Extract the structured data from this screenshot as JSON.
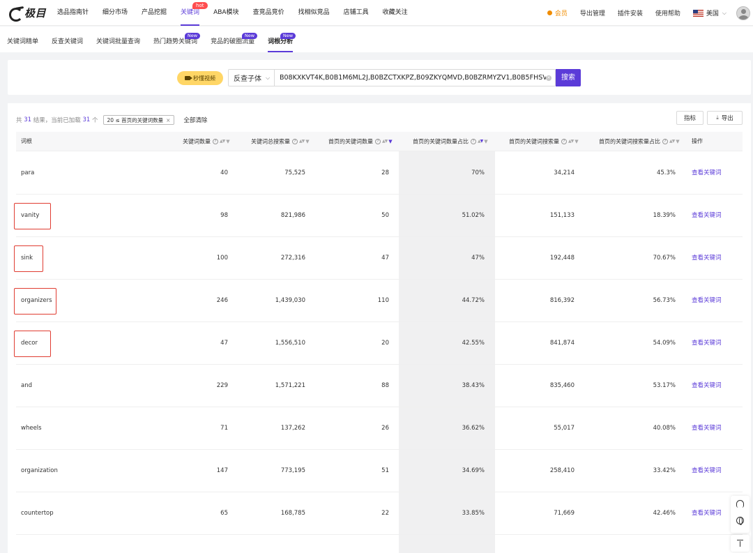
{
  "brand": {
    "logo_text": "极目"
  },
  "top_nav": {
    "items": [
      {
        "label": "选品指南针"
      },
      {
        "label": "细分市场"
      },
      {
        "label": "产品挖掘"
      },
      {
        "label": "关键词",
        "badge": "hot",
        "active": true
      },
      {
        "label": "ABA模块"
      },
      {
        "label": "查竞品竞价"
      },
      {
        "label": "找相似竞品"
      },
      {
        "label": "店铺工具"
      },
      {
        "label": "收藏关注"
      }
    ],
    "right": {
      "vip": "会员",
      "export_manage": "导出管理",
      "plugin_install": "插件安装",
      "help": "使用帮助",
      "region": "美国"
    }
  },
  "sub_nav": {
    "items": [
      {
        "label": "关键词精单"
      },
      {
        "label": "反查关键词"
      },
      {
        "label": "关键词批量查询"
      },
      {
        "label": "热门趋势关键词",
        "badge": "New"
      },
      {
        "label": "竞品的破圈流量",
        "badge": "New"
      },
      {
        "label": "词根分析",
        "badge": "New",
        "active": true
      }
    ]
  },
  "search": {
    "video_btn": "秒懂视频",
    "mode": "反查子体",
    "value": "B08KXKVT4K,B0B1M6ML2J,B0BZCTXKPZ,B09ZKYQMVD,B0BZRMYZV1,B0B5FHSV",
    "button": "搜索"
  },
  "summary": {
    "pre": "共",
    "total": "31",
    "mid": "结果，当前已加载",
    "loaded": "31",
    "post": "个",
    "filter_tag": "20 ≤ 首页的关键词数量",
    "clear_all": "全部清除",
    "metrics_btn": "指标",
    "export_btn": "导出"
  },
  "table": {
    "headers": {
      "root": "词根",
      "kw_count": "关键词数量",
      "kw_search_total": "关键词总搜索量",
      "home_kw_count": "首页的关键词数量",
      "home_kw_ratio": "首页的关键词数量占比",
      "home_kw_search": "首页的关键词搜索量",
      "home_kw_search_ratio": "首页的关键词搜索量占比",
      "action": "操作"
    },
    "rows": [
      {
        "root": "para",
        "kw_count": "40",
        "kw_search_total": "75,525",
        "home_kw_count": "28",
        "home_kw_ratio": "70%",
        "home_kw_search": "34,214",
        "home_kw_search_ratio": "45.3%",
        "action": "查看关键词"
      },
      {
        "root": "vanity",
        "kw_count": "98",
        "kw_search_total": "821,986",
        "home_kw_count": "50",
        "home_kw_ratio": "51.02%",
        "home_kw_search": "151,133",
        "home_kw_search_ratio": "18.39%",
        "action": "查看关键词"
      },
      {
        "root": "sink",
        "kw_count": "100",
        "kw_search_total": "272,316",
        "home_kw_count": "47",
        "home_kw_ratio": "47%",
        "home_kw_search": "192,448",
        "home_kw_search_ratio": "70.67%",
        "action": "查看关键词"
      },
      {
        "root": "organizers",
        "kw_count": "246",
        "kw_search_total": "1,439,030",
        "home_kw_count": "110",
        "home_kw_ratio": "44.72%",
        "home_kw_search": "816,392",
        "home_kw_search_ratio": "56.73%",
        "action": "查看关键词"
      },
      {
        "root": "decor",
        "kw_count": "47",
        "kw_search_total": "1,556,510",
        "home_kw_count": "20",
        "home_kw_ratio": "42.55%",
        "home_kw_search": "841,874",
        "home_kw_search_ratio": "54.09%",
        "action": "查看关键词"
      },
      {
        "root": "and",
        "kw_count": "229",
        "kw_search_total": "1,571,221",
        "home_kw_count": "88",
        "home_kw_ratio": "38.43%",
        "home_kw_search": "835,460",
        "home_kw_search_ratio": "53.17%",
        "action": "查看关键词"
      },
      {
        "root": "wheels",
        "kw_count": "71",
        "kw_search_total": "137,262",
        "home_kw_count": "26",
        "home_kw_ratio": "36.62%",
        "home_kw_search": "55,017",
        "home_kw_search_ratio": "40.08%",
        "action": "查看关键词"
      },
      {
        "root": "organization",
        "kw_count": "147",
        "kw_search_total": "773,195",
        "home_kw_count": "51",
        "home_kw_ratio": "34.69%",
        "home_kw_search": "258,410",
        "home_kw_search_ratio": "33.42%",
        "action": "查看关键词"
      },
      {
        "root": "countertop",
        "kw_count": "65",
        "kw_search_total": "168,785",
        "home_kw_count": "22",
        "home_kw_ratio": "33.85%",
        "home_kw_search": "71,669",
        "home_kw_search_ratio": "42.46%",
        "action": "查看关键词"
      }
    ]
  },
  "colors": {
    "accent": "#5b3bd8",
    "hot": "#ff4d4f",
    "vip": "#f08c00",
    "highlight_box": "#e03c31"
  }
}
